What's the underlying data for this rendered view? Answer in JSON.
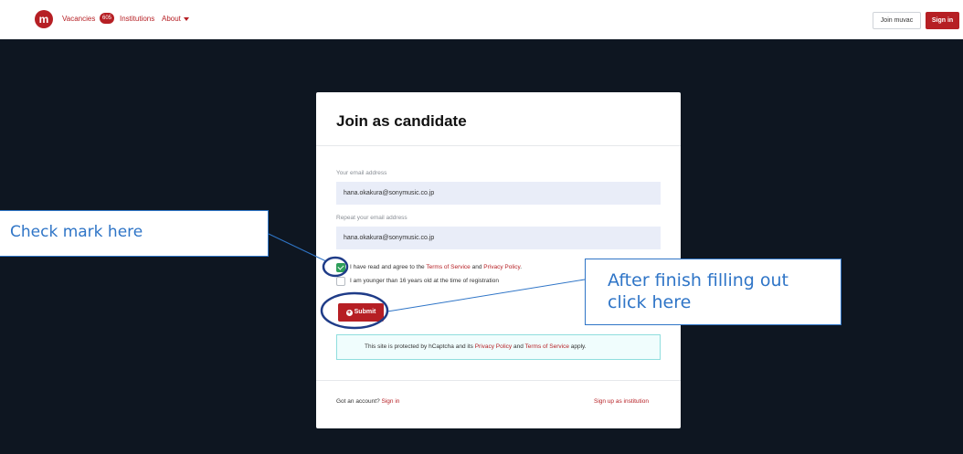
{
  "nav": {
    "logo_letter": "m",
    "vacancies_label": "Vacancies",
    "vacancies_count": "605",
    "institutions_label": "Institutions",
    "about_label": "About",
    "join_button": "Join muvac",
    "signin_button": "Sign in"
  },
  "form": {
    "title": "Join as candidate",
    "email_label": "Your email address",
    "email_value": "hana.okakura@sonymusic.co.jp",
    "repeat_email_label": "Repeat your email address",
    "repeat_email_value": "hana.okakura@sonymusic.co.jp",
    "terms_checkbox": {
      "checked": true,
      "prefix": "I have read and agree to the",
      "terms_link": "Terms of Service",
      "and_text": "and",
      "privacy_link": "Privacy Policy",
      "suffix": "."
    },
    "age_checkbox": {
      "checked": false,
      "label": "I am younger than 16 years old at the time of registration"
    },
    "submit_button": "Submit",
    "captcha": {
      "prefix": "This site is protected by hCaptcha and its",
      "privacy_link": "Privacy Policy",
      "and_text": "and",
      "terms_link": "Terms of Service",
      "suffix": "apply."
    },
    "footer": {
      "account_text": "Got an account?",
      "signin_link": "Sign in",
      "institution_link": "Sign up as institution"
    }
  },
  "annotations": {
    "check_callout": "Check mark here",
    "submit_callout_line1": "After finish filling out",
    "submit_callout_line2": "click here"
  },
  "colors": {
    "brand_red": "#b61f24",
    "dark_background": "#0e1621",
    "annotation_blue": "#2f75c7",
    "checkbox_green": "#2e9e5a"
  }
}
